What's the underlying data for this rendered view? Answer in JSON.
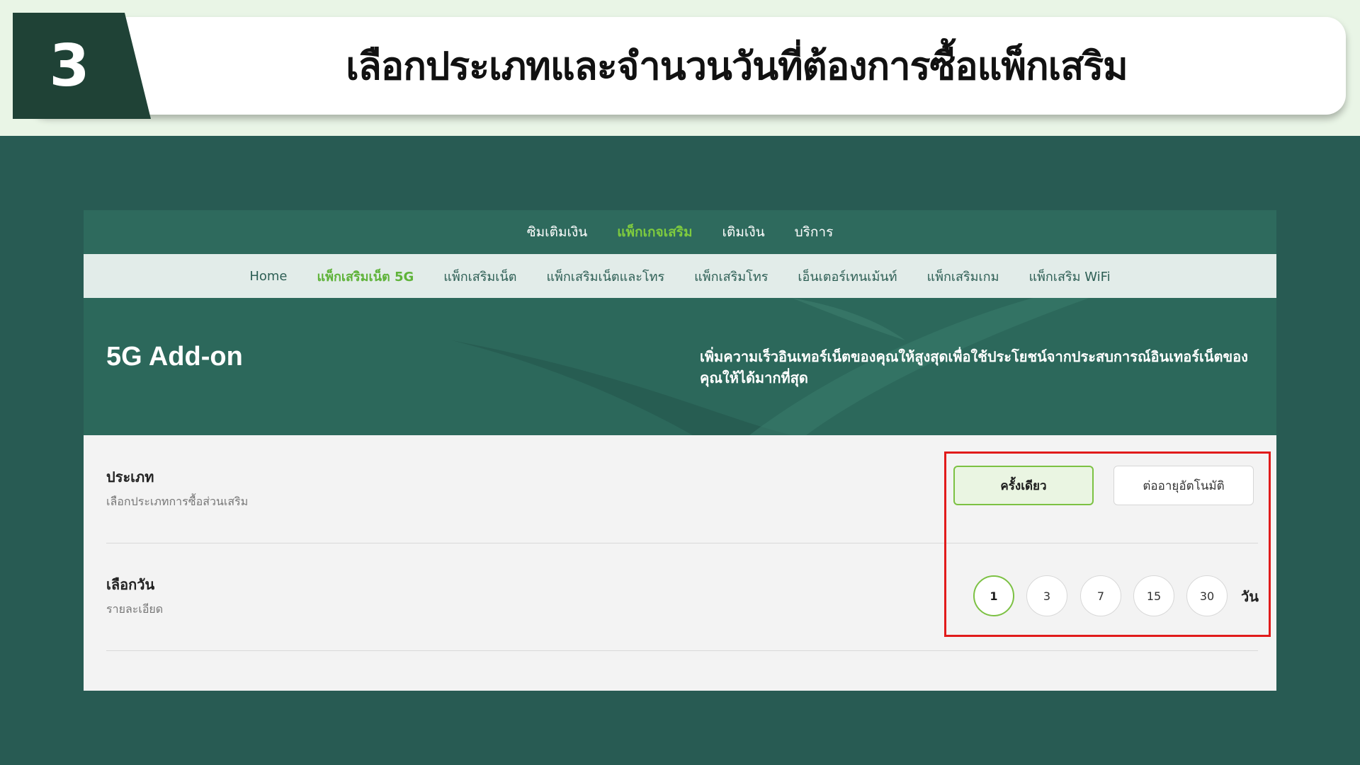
{
  "step": {
    "number": "3",
    "title": "เลือกประเภทและจำนวนวันที่ต้องการซื้อแพ็กเสริม"
  },
  "nav_main": {
    "items": [
      "ซิมเติมเงิน",
      "แพ็กเกจเสริม",
      "เติมเงิน",
      "บริการ"
    ],
    "active_index": 1
  },
  "nav_sub": {
    "items": [
      "Home",
      "แพ็กเสริมเน็ต 5G",
      "แพ็กเสริมเน็ต",
      "แพ็กเสริมเน็ตและโทร",
      "แพ็กเสริมโทร",
      "เอ็นเตอร์เทนเม้นท์",
      "แพ็กเสริมเกม",
      "แพ็กเสริม WiFi"
    ],
    "active_index": 1
  },
  "hero": {
    "title": "5G Add-on",
    "description": "เพิ่มความเร็วอินเทอร์เน็ตของคุณให้สูงสุดเพื่อใช้ประโยชน์จากประสบการณ์อินเทอร์เน็ตของคุณให้ได้มากที่สุด"
  },
  "type_section": {
    "label": "ประเภท",
    "sublabel": "เลือกประเภทการซื้อส่วนเสริม",
    "options": [
      "ครั้งเดียว",
      "ต่ออายุอัตโนมัติ"
    ],
    "selected_index": 0
  },
  "days_section": {
    "label": "เลือกวัน",
    "sublabel": "รายละเอียด",
    "options": [
      "1",
      "3",
      "7",
      "15",
      "30"
    ],
    "selected_index": 0,
    "unit": "วัน"
  },
  "colors": {
    "brand_dark": "#1f4236",
    "brand_green": "#2c685b",
    "accent_green": "#7cc143",
    "highlight_red": "#e11b1b"
  }
}
